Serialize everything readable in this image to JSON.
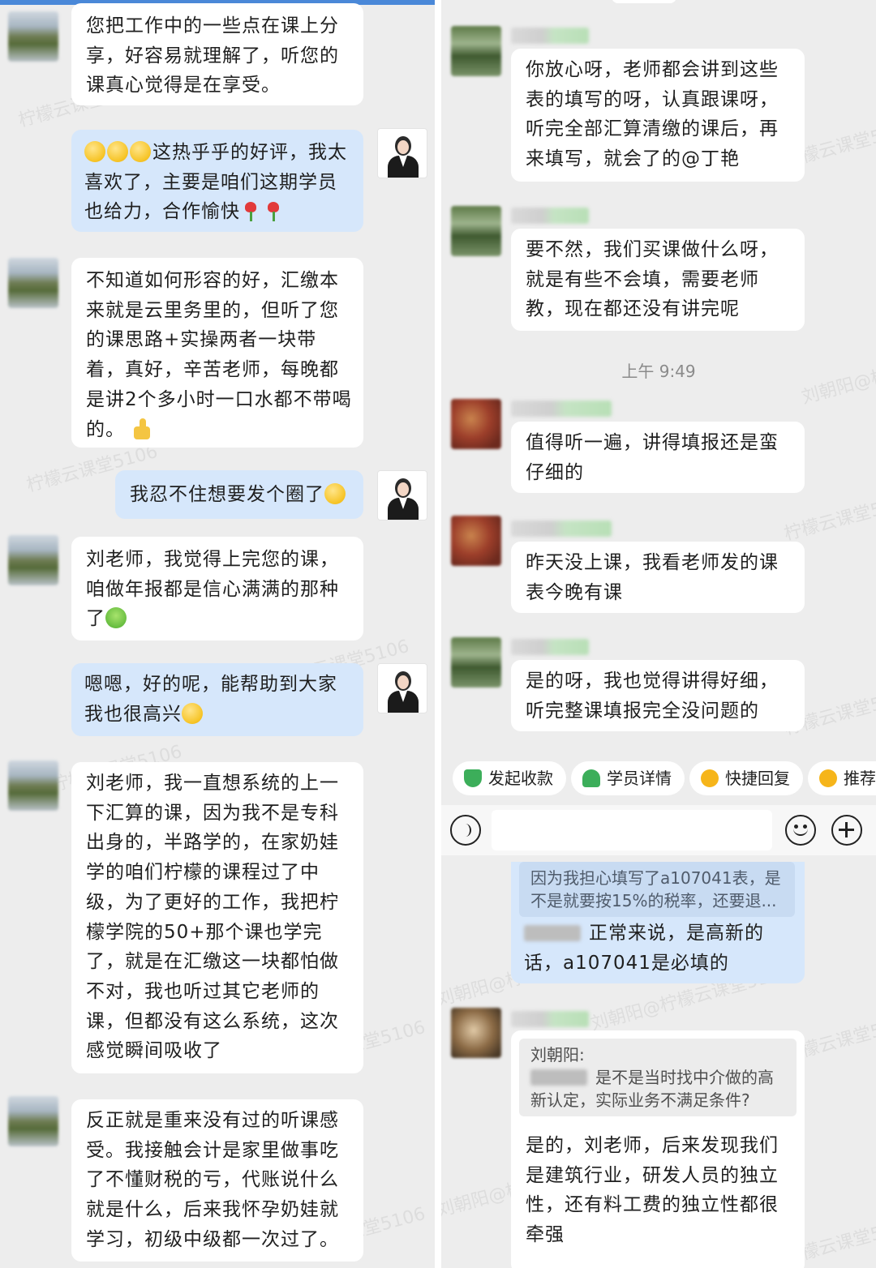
{
  "left": {
    "messages": [
      {
        "side": "left",
        "text": "您把工作中的一些点在课上分享，好容易就理解了，听您的课真心觉得是在享受。"
      },
      {
        "side": "right",
        "text": "这热乎乎的好评，我太喜欢了，主要是咱们这期学员也给力，合作愉快"
      },
      {
        "side": "left",
        "text": "不知道如何形容的好，汇缴本来就是云里务里的，但听了您的课思路+实操两者一块带着，真好，辛苦老师，每晚都是讲2个多小时一口水都不带喝的。"
      },
      {
        "side": "right",
        "text": "我忍不住想要发个圈了"
      },
      {
        "side": "left",
        "text": "刘老师，我觉得上完您的课，咱做年报都是信心满满的那种了"
      },
      {
        "side": "right",
        "text": "嗯嗯，好的呢，能帮助到大家我也很高兴"
      },
      {
        "side": "left",
        "text": "刘老师，我一直想系统的上一下汇算的课，因为我不是专科出身的，半路学的，在家奶娃学的咱们柠檬的课程过了中级，为了更好的工作，我把柠檬学院的50+那个课也学完了，就是在汇缴这一块都怕做不对，我也听过其它老师的课，但都没有这么系统，这次感觉瞬间吸收了"
      },
      {
        "side": "left",
        "text": "反正就是重来没有过的听课感受。我接触会计是家里做事吃了不懂财税的亏，代账说什么就是什么，后来我怀孕奶娃就学习，初级中级都一次过了。"
      }
    ],
    "watermarks": [
      "柠檬云课堂5106",
      "刘朝阳@柠檬云课堂5106"
    ]
  },
  "right": {
    "messages": [
      {
        "text": "你放心呀，老师都会讲到这些表的填写的呀，认真跟课呀，听完全部汇算清缴的课后，再来填写，就会了的@丁艳"
      },
      {
        "text": "要不然，我们买课做什么呀，就是有些不会填，需要老师教，现在都还没有讲完呢"
      },
      {
        "text": "值得听一遍，讲得填报还是蛮仔细的"
      },
      {
        "text": "昨天没上课，我看老师发的课表今晚有课"
      },
      {
        "text": "是的呀，我也觉得讲得好细，听完整课填报完全没问题的"
      }
    ],
    "timestamp": "上午 9:49",
    "quick_actions": [
      "发起收款",
      "学员详情",
      "快捷回复",
      "推荐"
    ],
    "input_placeholder": "",
    "quoted_reply": {
      "quote_text": "因为我担心填写了a107041表，是不是就要按15%的税率，还要退...",
      "reply_text": "正常来说，是高新的话，a107041是必填的"
    },
    "last_message": {
      "quote_author": "刘朝阳:",
      "quote_text": "是不是当时找中介做的高新认定，实际业务不满足条件?",
      "text": "是的，刘老师，后来发现我们是建筑行业，研发人员的独立性，还有料工费的独立性都很牵强"
    },
    "watermarks": [
      "刘朝阳@柠檬云课堂5106",
      "柠檬云课堂5106"
    ]
  },
  "colors": {
    "chat_bg": "#ededed",
    "bubble_self": "#d6e7fb",
    "bubble_other": "#ffffff",
    "accent_green": "#4caf50"
  }
}
